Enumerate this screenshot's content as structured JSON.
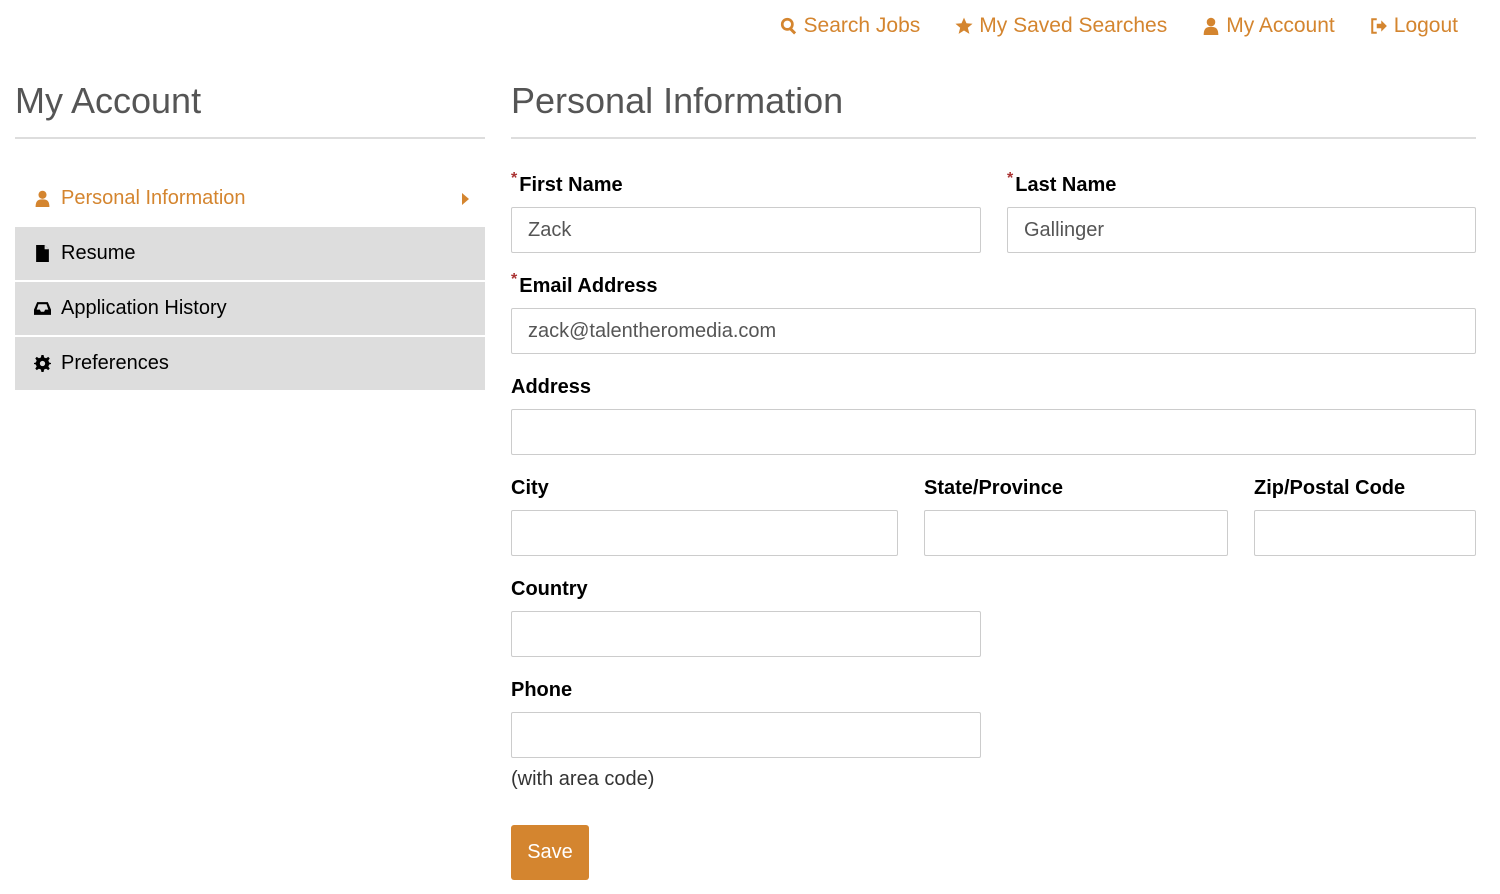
{
  "topnav": [
    {
      "label": "Search Jobs",
      "icon": "search-icon"
    },
    {
      "label": "My Saved Searches",
      "icon": "star-icon"
    },
    {
      "label": "My Account",
      "icon": "user-icon"
    },
    {
      "label": "Logout",
      "icon": "logout-icon"
    }
  ],
  "sidebar": {
    "title": "My Account",
    "items": [
      {
        "label": "Personal Information",
        "icon": "user-icon",
        "active": true
      },
      {
        "label": "Resume",
        "icon": "file-icon"
      },
      {
        "label": "Application History",
        "icon": "inbox-icon"
      },
      {
        "label": "Preferences",
        "icon": "gear-icon"
      }
    ]
  },
  "main": {
    "title": "Personal Information",
    "required_mark": "*",
    "fields": {
      "first_name": {
        "label": "First Name",
        "value": "Zack"
      },
      "last_name": {
        "label": "Last Name",
        "value": "Gallinger"
      },
      "email": {
        "label": "Email Address",
        "value": "zack@talentheromedia.com"
      },
      "address": {
        "label": "Address",
        "value": ""
      },
      "city": {
        "label": "City",
        "value": ""
      },
      "state": {
        "label": "State/Province",
        "value": ""
      },
      "zip": {
        "label": "Zip/Postal Code",
        "value": ""
      },
      "country": {
        "label": "Country",
        "value": ""
      },
      "phone": {
        "label": "Phone",
        "value": "",
        "help": "(with area code)"
      }
    },
    "save_label": "Save"
  },
  "colors": {
    "accent": "#d4852f",
    "menu_bg": "#dddddd"
  }
}
